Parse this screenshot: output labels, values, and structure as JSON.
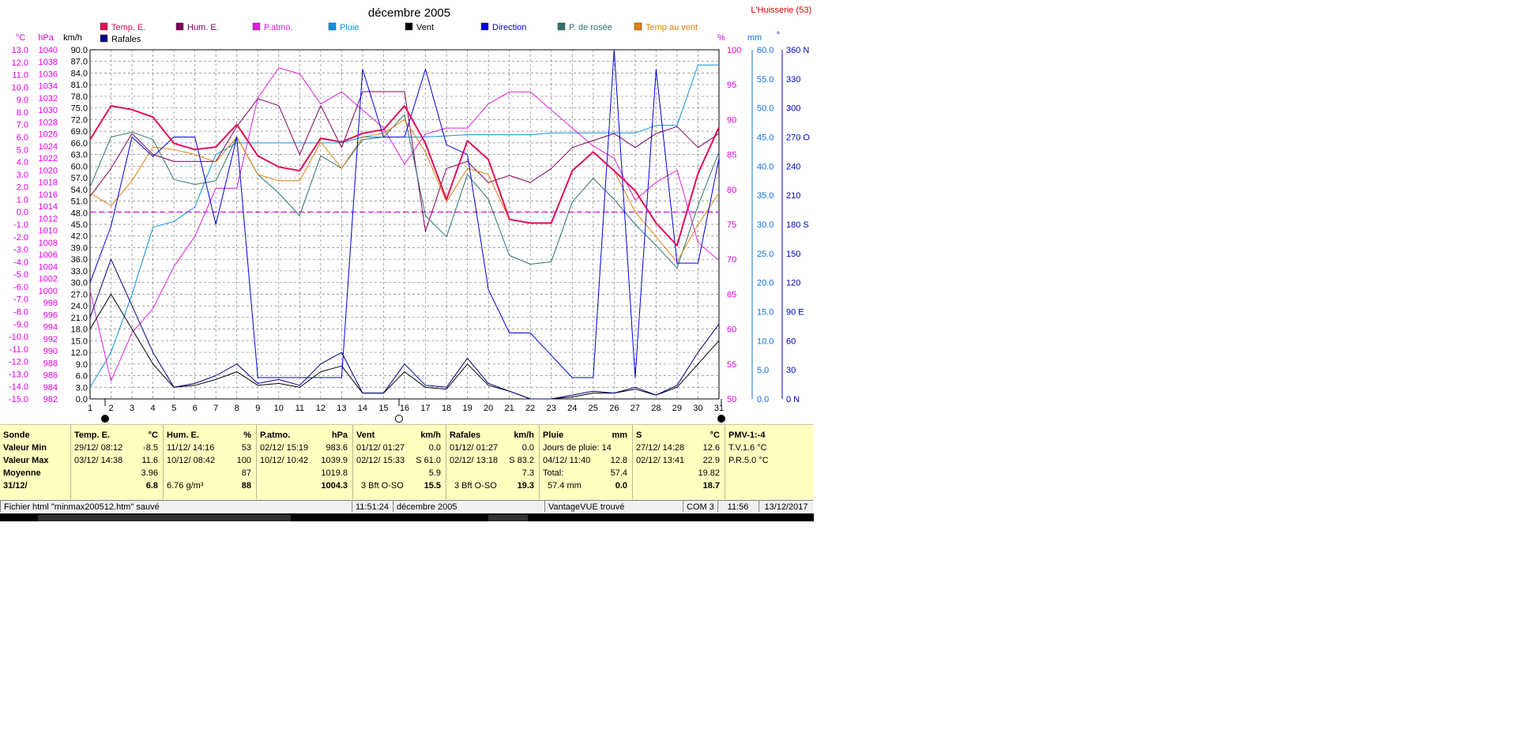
{
  "window": {
    "title": "décembre 2005",
    "station": "L'Huisserie (53)"
  },
  "legend": [
    {
      "name": "Temp. E.",
      "color": "#e0105a"
    },
    {
      "name": "Hum. E.",
      "color": "#800060"
    },
    {
      "name": "P.atmo.",
      "color": "#e020e0"
    },
    {
      "name": "Pluie",
      "color": "#1090e0"
    },
    {
      "name": "Vent",
      "color": "#000000"
    },
    {
      "name": "Direction",
      "color": "#0000e0"
    },
    {
      "name": "P. de rosée",
      "color": "#307070"
    },
    {
      "name": "Temp au vent",
      "color": "#e08010"
    },
    {
      "name": "Rafales",
      "color": "#000080"
    }
  ],
  "axes_units": {
    "temp": "°C",
    "pressure": "hPa",
    "wind": "km/h",
    "humidity": "%",
    "rain": "mm",
    "direction": "°"
  },
  "chart_data": {
    "type": "line",
    "title": "décembre 2005",
    "x": [
      1,
      2,
      3,
      4,
      5,
      6,
      7,
      8,
      9,
      10,
      11,
      12,
      13,
      14,
      15,
      16,
      17,
      18,
      19,
      20,
      21,
      22,
      23,
      24,
      25,
      26,
      27,
      28,
      29,
      30,
      31
    ],
    "axes": {
      "temp": {
        "range": [
          -15.0,
          13.0
        ],
        "ticks": [
          "13.0",
          "12.0",
          "11.0",
          "10.0",
          "9.0",
          "8.0",
          "7.0",
          "6.0",
          "5.0",
          "4.0",
          "3.0",
          "2.0",
          "1.0",
          "0.0",
          "-1.0",
          "-2.0",
          "-3.0",
          "-4.0",
          "-5.0",
          "-6.0",
          "-7.0",
          "-8.0",
          "-9.0",
          "-10.0",
          "-11.0",
          "-12.0",
          "-13.0",
          "-14.0",
          "-15.0"
        ]
      },
      "pressure": {
        "range": [
          982,
          1040
        ],
        "ticks": [
          "1040",
          "1038",
          "1036",
          "1034",
          "1032",
          "1030",
          "1028",
          "1026",
          "1024",
          "1022",
          "1020",
          "1018",
          "1016",
          "1014",
          "1012",
          "1010",
          "1008",
          "1006",
          "1004",
          "1002",
          "1000",
          "998",
          "996",
          "994",
          "992",
          "990",
          "988",
          "986",
          "984",
          "982"
        ]
      },
      "wind": {
        "range": [
          0,
          90
        ],
        "ticks": [
          "90.0",
          "87.0",
          "84.0",
          "81.0",
          "78.0",
          "75.0",
          "72.0",
          "69.0",
          "66.0",
          "63.0",
          "60.0",
          "57.0",
          "54.0",
          "51.0",
          "48.0",
          "45.0",
          "42.0",
          "39.0",
          "36.0",
          "33.0",
          "30.0",
          "27.0",
          "24.0",
          "21.0",
          "18.0",
          "15.0",
          "12.0",
          "9.0",
          "6.0",
          "3.0",
          "0.0"
        ]
      },
      "humidity": {
        "range": [
          50,
          100
        ],
        "ticks": [
          "100",
          "95",
          "90",
          "85",
          "80",
          "75",
          "70",
          "65",
          "60",
          "55",
          "50"
        ]
      },
      "rain": {
        "range": [
          0,
          60
        ],
        "ticks": [
          "60.0",
          "55.0",
          "50.0",
          "45.0",
          "40.0",
          "35.0",
          "30.0",
          "25.0",
          "20.0",
          "15.0",
          "10.0",
          "5.0",
          "0.0"
        ]
      },
      "direction": {
        "range": [
          0,
          360
        ],
        "ticks": [
          "360 N",
          "330",
          "300",
          "270 O",
          "240",
          "210",
          "180 S",
          "150",
          "120",
          "90  E",
          "60",
          "30",
          "0   N"
        ]
      }
    },
    "reference_line": {
      "axis": "temp",
      "value": 0.0,
      "color": "#e020e0"
    },
    "series": [
      {
        "name": "Temp. E.",
        "axis": "temp",
        "color": "#e0105a",
        "width": 2,
        "values": [
          5.8,
          8.5,
          8.2,
          7.6,
          5.5,
          5.0,
          5.2,
          7.0,
          4.5,
          3.6,
          3.3,
          5.9,
          5.6,
          6.3,
          6.6,
          8.5,
          5.5,
          1.0,
          5.7,
          4.2,
          -0.6,
          -0.9,
          -0.9,
          3.3,
          4.8,
          3.3,
          1.7,
          -0.9,
          -2.7,
          3.1,
          6.8
        ]
      },
      {
        "name": "Hum. E.",
        "axis": "humidity",
        "color": "#800060",
        "width": 1,
        "values": [
          79,
          83,
          88,
          85,
          84,
          84,
          84,
          89,
          93,
          92,
          85,
          92,
          86,
          94,
          94,
          94,
          74,
          83,
          84,
          81,
          82,
          81,
          83,
          86,
          87,
          88,
          86,
          88,
          89,
          86,
          88
        ]
      },
      {
        "name": "P.atmo.",
        "axis": "pressure",
        "color": "#e020e0",
        "width": 1,
        "values": [
          1000,
          985,
          993,
          997,
          1004,
          1009,
          1017,
          1017,
          1032,
          1037,
          1036,
          1031,
          1033,
          1030,
          1027,
          1021,
          1026,
          1027,
          1027,
          1031,
          1033,
          1033,
          1030,
          1027,
          1024,
          1022,
          1015,
          1018,
          1020,
          1008,
          1005
        ]
      },
      {
        "name": "Pluie",
        "axis": "rain",
        "color": "#1090e0",
        "width": 1,
        "values": [
          2.0,
          8.0,
          18.0,
          29.5,
          30.5,
          33.0,
          42.0,
          44.0,
          44.0,
          44.0,
          44.0,
          44.0,
          44.0,
          45.0,
          45.0,
          45.0,
          45.0,
          45.2,
          45.4,
          45.4,
          45.4,
          45.4,
          45.7,
          45.7,
          45.7,
          45.7,
          45.7,
          47.0,
          47.0,
          57.4,
          57.4
        ]
      },
      {
        "name": "Vent",
        "axis": "wind",
        "color": "#000000",
        "width": 1,
        "values": [
          18.0,
          27.0,
          18.0,
          9.0,
          3.0,
          3.5,
          5.0,
          7.0,
          3.5,
          4.0,
          3.0,
          7.0,
          8.5,
          1.5,
          1.5,
          7.0,
          3.0,
          2.5,
          9.0,
          3.5,
          2.0,
          0.0,
          0.0,
          0.5,
          1.5,
          1.5,
          2.5,
          1.0,
          3.0,
          9.0,
          15.0
        ]
      },
      {
        "name": "Rafales",
        "axis": "wind",
        "color": "#000080",
        "width": 1,
        "values": [
          21.0,
          36.0,
          24.0,
          12.0,
          3.0,
          4.0,
          6.0,
          9.0,
          4.0,
          5.0,
          3.5,
          9.0,
          12.0,
          1.5,
          1.5,
          9.0,
          3.5,
          3.0,
          10.5,
          4.0,
          2.0,
          0.0,
          0.0,
          1.0,
          2.0,
          1.5,
          3.0,
          1.0,
          3.5,
          12.0,
          19.3
        ]
      },
      {
        "name": "Direction",
        "axis": "direction",
        "color": "#0000e0",
        "width": 1,
        "values": [
          120,
          178,
          270,
          250,
          270,
          270,
          180,
          270,
          22,
          22,
          22,
          22,
          22,
          340,
          270,
          270,
          340,
          262,
          252,
          113,
          68,
          68,
          45,
          22,
          22,
          360,
          22,
          340,
          140,
          140,
          248
        ]
      },
      {
        "name": "P. de rosée",
        "axis": "temp",
        "color": "#307070",
        "width": 1,
        "values": [
          2.0,
          6.0,
          6.4,
          5.8,
          2.6,
          2.2,
          2.5,
          6.0,
          3.0,
          1.5,
          -0.3,
          4.5,
          3.5,
          5.8,
          6.0,
          7.8,
          -0.3,
          -2.0,
          3.0,
          1.0,
          -3.5,
          -4.2,
          -4.0,
          0.8,
          2.7,
          1.0,
          -1.0,
          -2.7,
          -4.5,
          0.5,
          4.8
        ]
      },
      {
        "name": "Temp au vent",
        "axis": "temp",
        "color": "#e08010",
        "width": 1,
        "values": [
          1.5,
          0.5,
          2.5,
          5.2,
          5.0,
          4.6,
          4.0,
          6.0,
          3.0,
          2.5,
          2.5,
          5.6,
          3.5,
          6.0,
          6.3,
          7.4,
          4.8,
          0.8,
          3.5,
          3.0,
          -0.6,
          -0.9,
          -0.9,
          3.3,
          4.8,
          3.3,
          0.0,
          -2.0,
          -4.0,
          -1.0,
          1.5
        ]
      }
    ]
  },
  "stats": {
    "sonde": {
      "header": "Sonde",
      "min": "Valeur Min",
      "max": "Valeur Max",
      "mean": "Moyenne",
      "date": "31/12/"
    },
    "temp": {
      "header": "Temp. E.",
      "unit": "°C",
      "min_date": "29/12/  08:12",
      "min_val": "-8.5",
      "max_date": "03/12/  14:38",
      "max_val": "11.6",
      "mean": "3.96",
      "last": "6.8"
    },
    "hum": {
      "header": "Hum. E.",
      "unit": "%",
      "min_date": "11/12/  14:16",
      "min_val": "53",
      "max_date": "10/12/  08:42",
      "max_val": "100",
      "mean": "87",
      "abs": "6.76 g/m³",
      "last": "88"
    },
    "patmo": {
      "header": "P.atmo.",
      "unit": "hPa",
      "min_date": "02/12/  15:19",
      "min_val": "983.6",
      "max_date": "10/12/  10:42",
      "max_val": "1039.9",
      "mean": "1019.8",
      "last": "1004.3"
    },
    "vent": {
      "header": "Vent",
      "unit": "km/h",
      "min_date": "01/12/  01:27",
      "min_val": "0.0",
      "max_date": "02/12/  15:33",
      "max_val": "S 61.0",
      "mean": "5.9",
      "beaufort": "3 Bft O-SO",
      "last": "15.5"
    },
    "rafales": {
      "header": "Rafales",
      "unit": "km/h",
      "min_date": "01/12/  01:27",
      "min_val": "0.0",
      "max_date": "02/12/  13:18",
      "max_val": "S 83.2",
      "mean": "7.3",
      "beaufort": "3 Bft O-SO",
      "last": "19.3"
    },
    "pluie": {
      "header": "Pluie",
      "unit": "mm",
      "days": "Jours de pluie: 14",
      "max_date": "04/12/  11:40",
      "max_val": "12.8",
      "total_label": "Total:",
      "total": "57.4",
      "last_label": "57.4 mm",
      "last": "0.0"
    },
    "s": {
      "header": "S",
      "unit": "°C",
      "min_date": "27/12/  14:28",
      "min_val": "12.6",
      "max_date": "02/12/  13:41",
      "max_val": "22.9",
      "mean": "19.82",
      "last": "18.7"
    },
    "pmv": {
      "header": "PMV-1:-4",
      "tv": "T.V.1.6 °C",
      "pr": "P.R.5.0 °C"
    }
  },
  "statusbar": {
    "file": "Fichier html  \"minmax200512.htm\"  sauvé",
    "time1": "11:51:24",
    "month": "décembre 2005",
    "vantage": "VantageVUE trouvé",
    "com": "COM 3",
    "time2": "11:56",
    "date": "13/12/2017"
  }
}
